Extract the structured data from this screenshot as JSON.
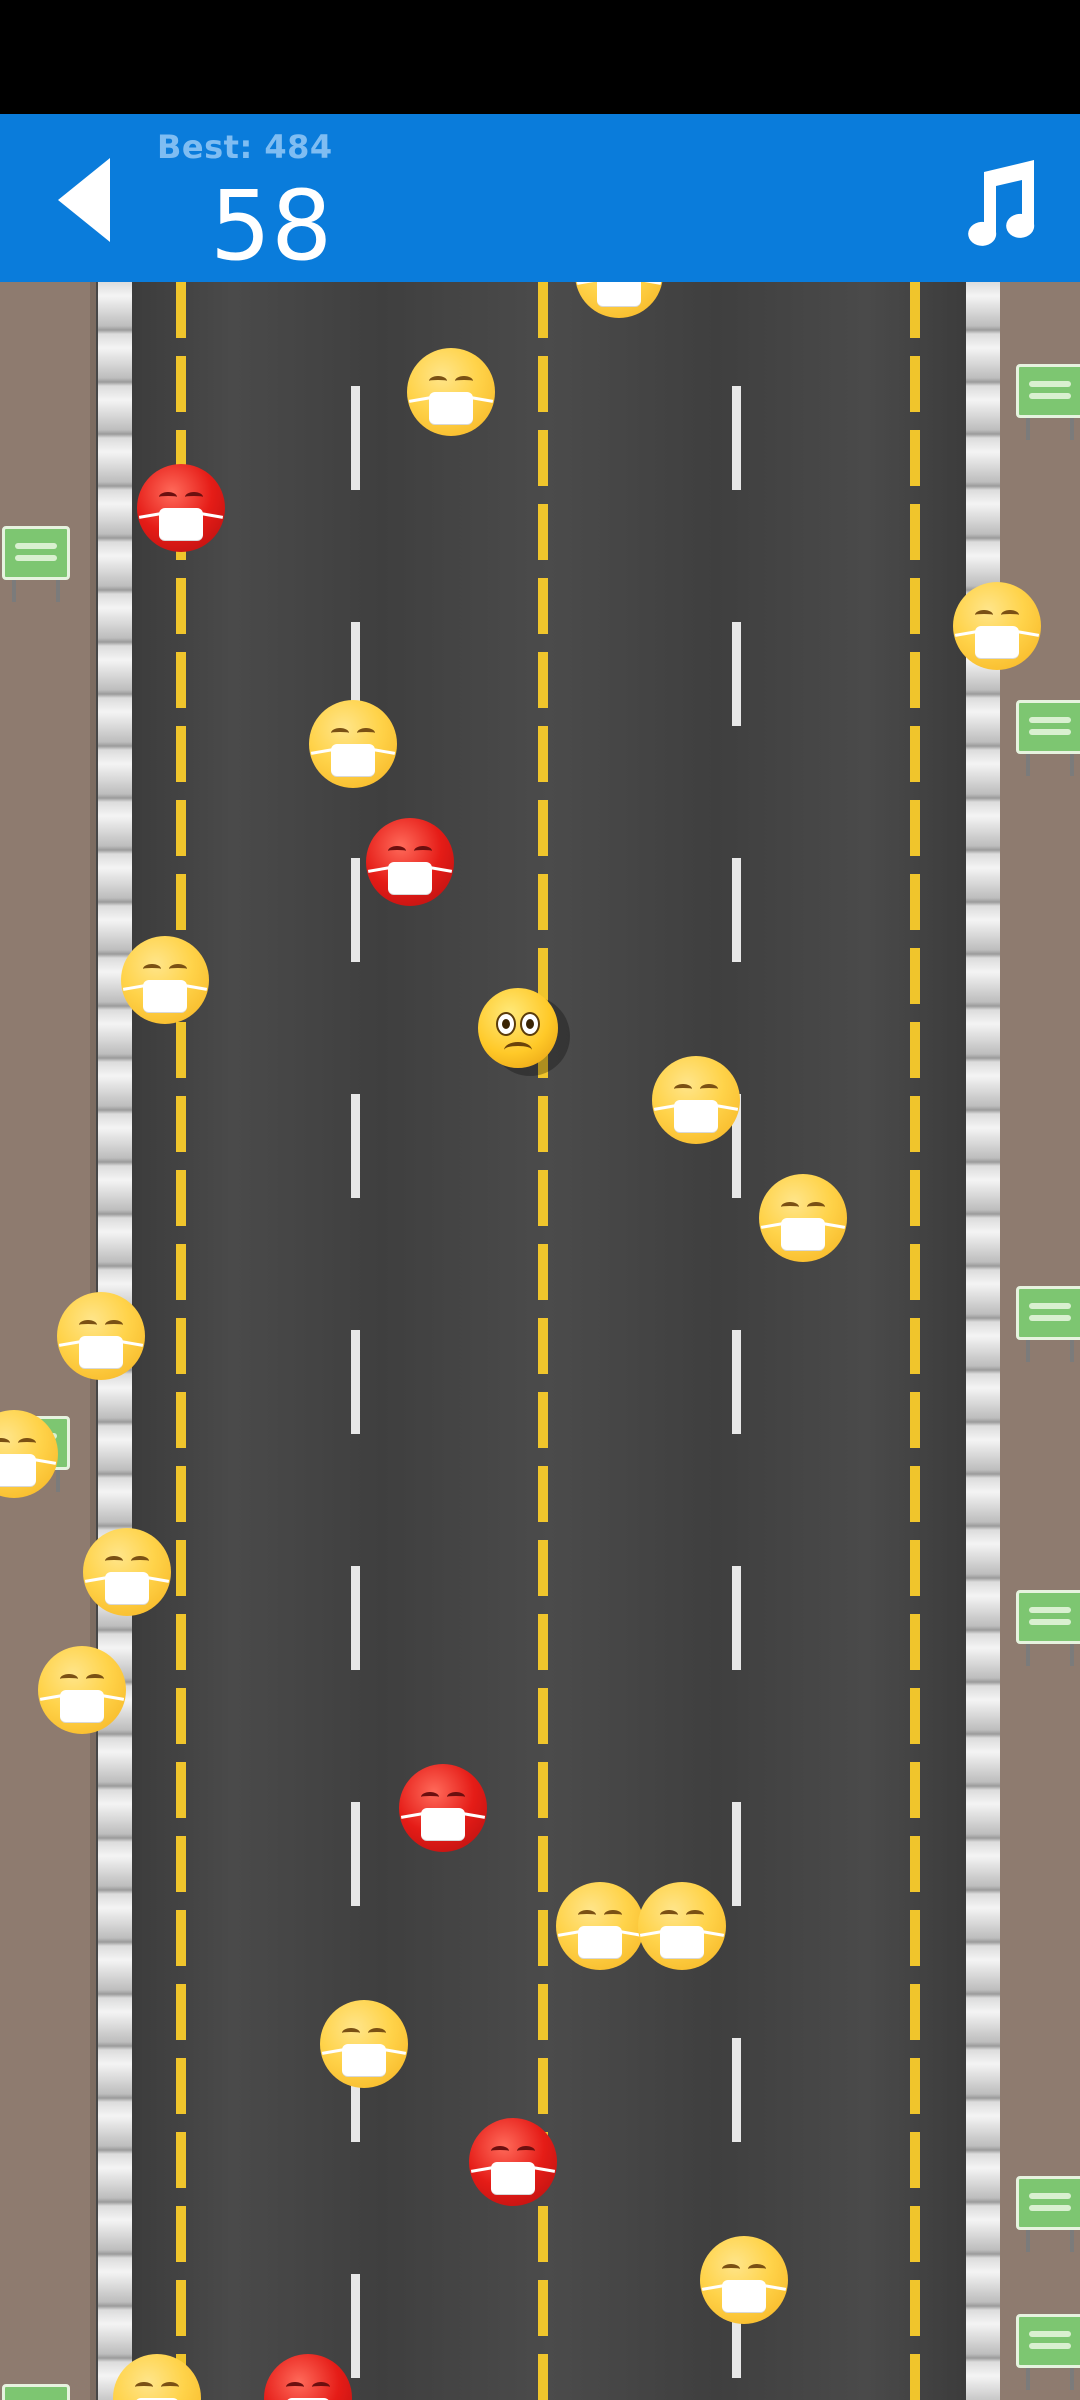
{
  "header": {
    "best_label": "Best: 484",
    "score": "58"
  },
  "icons": {
    "back": "back-triangle-icon",
    "music": "music-note-icon"
  },
  "colors": {
    "header_bg": "#0a7cdb",
    "best_text": "#7fbdf2",
    "road": "#474747",
    "lane_yellow": "#f0c52c",
    "lane_white": "#e8e8e8",
    "dirt": "#8e7b6f",
    "masked_emoji": "#ffd34a",
    "sick_emoji": "#e51c17"
  }
}
